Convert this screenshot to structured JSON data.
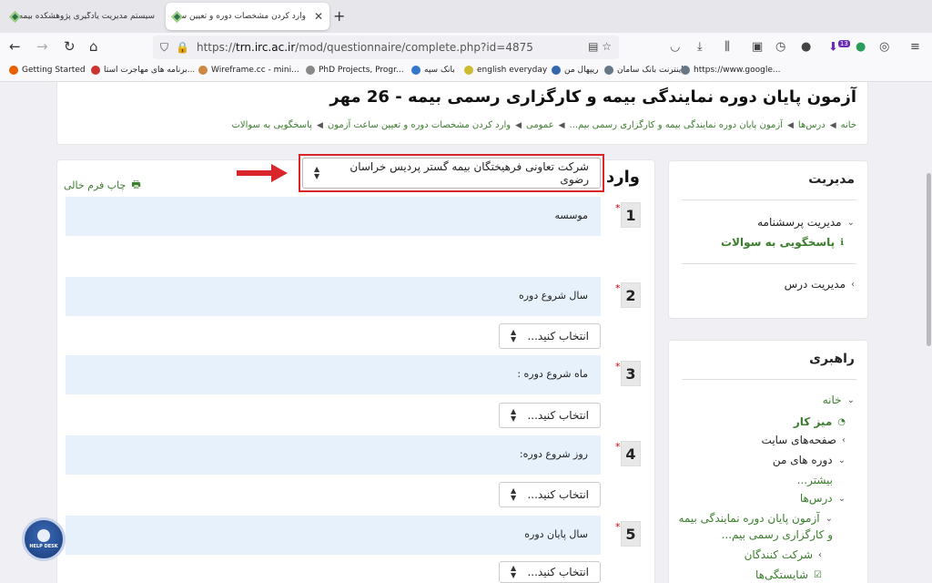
{
  "tabs": [
    {
      "title": "سیستم مدیریت یادگیری پژوهشکده بیمه",
      "active": false
    },
    {
      "title": "وارد کردن مشخصات دوره و تعیین ساعت",
      "active": true
    }
  ],
  "url": {
    "prefix": "https://",
    "host": "trn.irc.ac.ir",
    "path": "/mod/questionnaire/complete.php?id=4875"
  },
  "bookmarks": [
    "Getting Started",
    "برنامه های مهاجرت استا...",
    "Wireframe.cc - mini...",
    "PhD Projects, Progr...",
    "بانک سپه",
    "english everyday",
    "ریپهال من",
    "اینترنت بانک سامان",
    "https://www.google..."
  ],
  "toolbar_badges": {
    "downloads_count": "13"
  },
  "header": {
    "title": "آزمون پایان دوره نمایندگی بیمه و کارگزاری رسمی بیمه - 26 مهر",
    "breadcrumb": [
      "خانه",
      "درس‌ها",
      "آزمون پایان دوره نمایندگی بیمه و کارگزاری رسمی بیم...",
      "عمومی",
      "وارد کردن مشخصات دوره و تعیین ساعت آزمون",
      "پاسخگویی به سوالات"
    ]
  },
  "form": {
    "title": "وارد کردن مشخصات دوره",
    "print_label": "چاپ فرم خالی",
    "required_mark": "*",
    "questions": [
      {
        "num": "1",
        "label": "موسسه",
        "value": "شرکت تعاونی فرهیختگان بیمه گستر پردیس خراسان رضوی"
      },
      {
        "num": "2",
        "label": "سال شروع دوره",
        "value": "انتخاب کنید..."
      },
      {
        "num": "3",
        "label": "ماه شروع دوره :",
        "value": "انتخاب کنید..."
      },
      {
        "num": "4",
        "label": "روز شروع دوره:",
        "value": "انتخاب کنید..."
      },
      {
        "num": "5",
        "label": "سال پایان دوره",
        "value": "انتخاب کنید..."
      }
    ]
  },
  "admin_block": {
    "title": "مدیریت",
    "items": [
      "مدیریت پرسشنامه",
      "پاسخگویی به سوالات",
      "مدیریت درس"
    ]
  },
  "nav_block": {
    "title": "راهبری",
    "items": [
      "خانه",
      "میز کار",
      "صفحه‌های سایت",
      "دوره های من",
      "بیشتر...",
      "درس‌ها",
      "آزمون پایان دوره نمایندگی بیمه",
      "و کارگزاری رسمی بیم...",
      "شرکت کنندگان",
      "شایستگی‌ها"
    ]
  },
  "helpdesk_label": "HELP DESK",
  "colors": {
    "link": "#3a7d2c",
    "question_bg": "#e7f1fb",
    "highlight": "#d9262b"
  }
}
